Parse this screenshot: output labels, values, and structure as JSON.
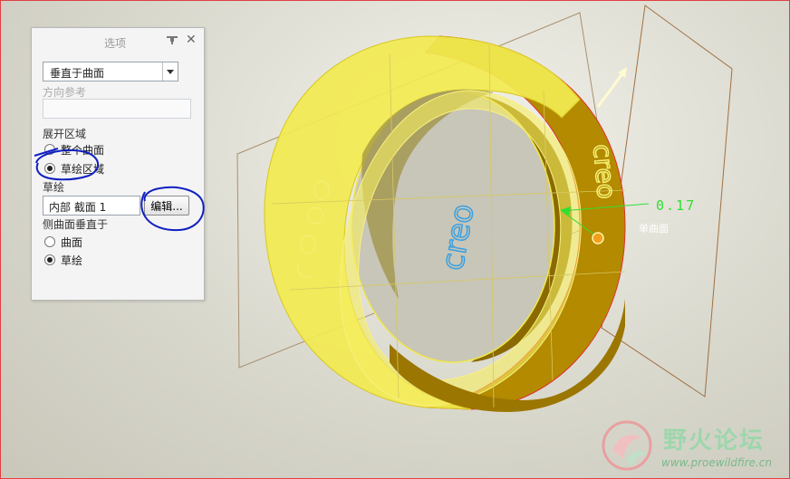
{
  "panel": {
    "title": "选项",
    "direction_type": "垂直于曲面",
    "direction_ref_label": "方向参考",
    "expand_region_label": "展开区域",
    "option_whole_surface": "整个曲面",
    "option_sketch_region": "草绘区域",
    "sketch_label": "草绘",
    "sketch_value": "内部 截面 1",
    "edit_button": "编辑...",
    "side_normal_label": "侧曲面垂直于",
    "option_surface": "曲面",
    "option_sketch": "草绘",
    "selected_expand_option": "草绘区域",
    "selected_side_option": "草绘"
  },
  "viewport": {
    "dimension_value": "0.17",
    "surface_label": "单曲面",
    "embossed_text": "creo"
  },
  "watermark": {
    "title": "野火论坛",
    "url": "www.proewildfire.cn"
  },
  "colors": {
    "part_yellow": "#f0e640",
    "part_dark": "#b08a00",
    "edge_red": "#e03030",
    "dimension_green": "#30e030",
    "annotation_blue": "#1020c0",
    "text_blue": "#3aa0e0"
  }
}
